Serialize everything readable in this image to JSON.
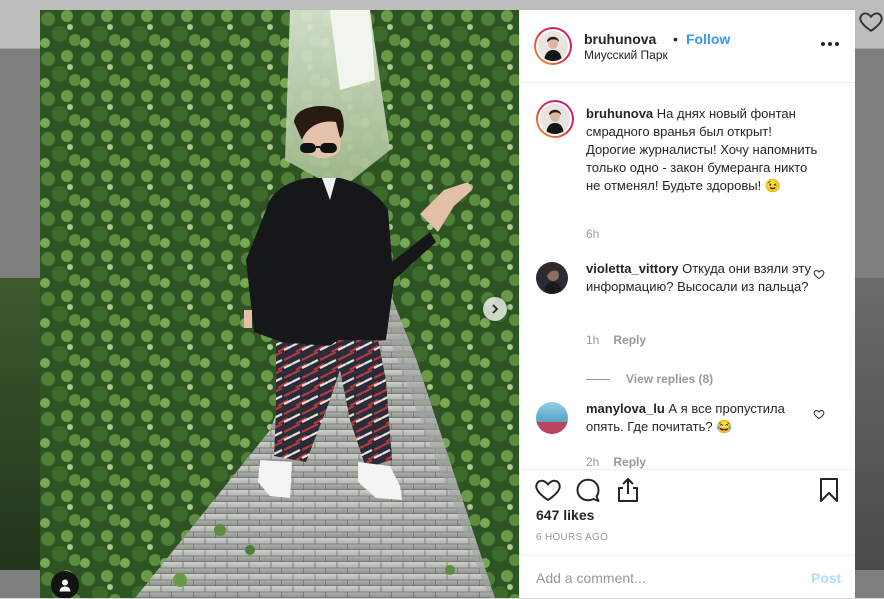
{
  "post": {
    "username": "bruhunova",
    "dot": "•",
    "follow_label": "Follow",
    "location": "Миусский Парк"
  },
  "caption": {
    "username": "bruhunova",
    "text": "На днях новый фонтан смрадного вранья был открыт! Дорогие журналисты! Хочу напомнить только одно - закон бумеранга никто не отменял! Будьте здоровы! 😉",
    "time": "6h"
  },
  "comments": [
    {
      "username": "violetta_vittory",
      "text": "Откуда они взяли эту информацию? Высосали из пальца?",
      "time": "1h",
      "reply_label": "Reply",
      "view_replies": "View replies (8)"
    },
    {
      "username": "manylova_lu",
      "text": "А я все пропустила опять. Где почитать? 😂",
      "time": "2h",
      "reply_label": "Reply"
    }
  ],
  "likes": "647 likes",
  "posted_time": "6 HOURS AGO",
  "add_comment": {
    "placeholder": "Add a comment...",
    "post_label": "Post"
  },
  "colors": {
    "accent": "#3897f0",
    "post_disabled": "#b2dffc",
    "text": "#262626",
    "muted": "#999999"
  },
  "icons": [
    "more-icon",
    "heart-icon",
    "comment-icon",
    "share-icon",
    "bookmark-icon",
    "chevron-right-icon",
    "user-tag-icon"
  ]
}
